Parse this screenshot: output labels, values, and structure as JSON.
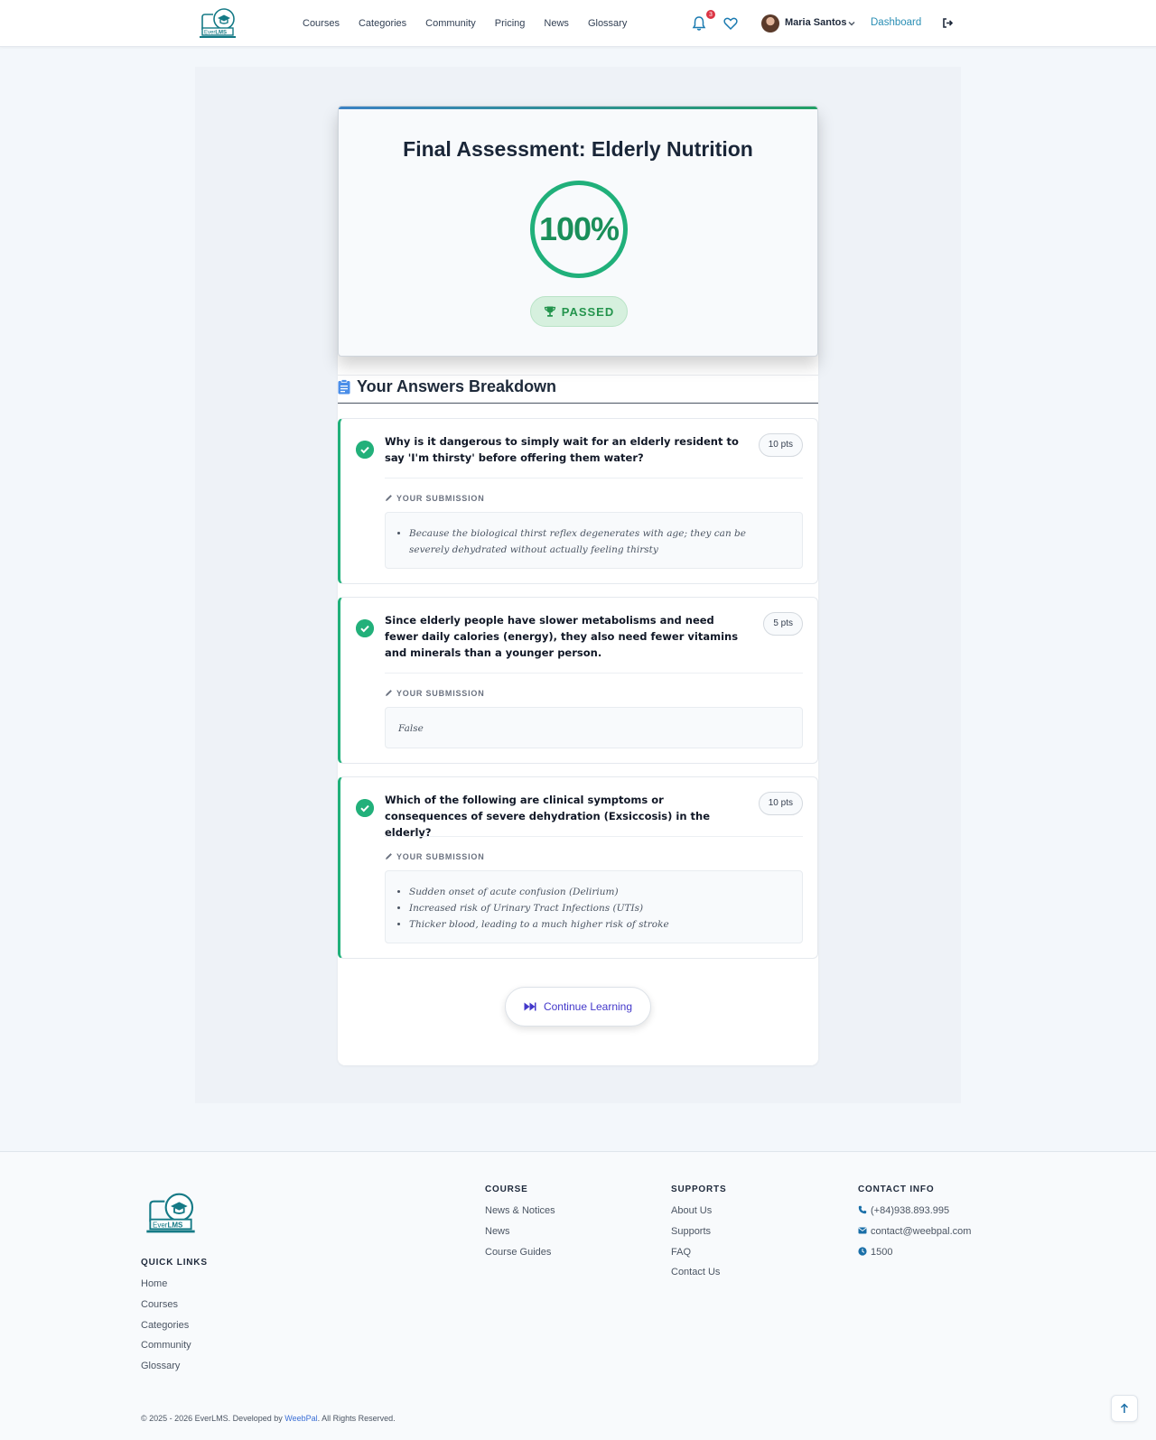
{
  "header": {
    "nav": [
      "Courses",
      "Categories",
      "Community",
      "Pricing",
      "News",
      "Glossary"
    ],
    "notification_count": "3",
    "user_name": "Maria Santos",
    "dashboard_label": "Dashboard"
  },
  "result": {
    "title": "Final Assessment: Elderly Nutrition",
    "score": "100%",
    "status": "PASSED"
  },
  "breakdown": {
    "title": "Your Answers Breakdown",
    "submission_label": "YOUR SUBMISSION",
    "questions": [
      {
        "text": "Why is it dangerous to simply wait for an elderly resident to say 'I'm thirsty' before offering them water?",
        "points": "10 pts",
        "answers": [
          "Because the biological thirst reflex degenerates with age; they can be severely dehydrated without actually feeling thirsty"
        ]
      },
      {
        "text": "Since elderly people have slower metabolisms and need fewer daily calories (energy), they also need fewer vitamins and minerals than a younger person.",
        "points": "5 pts",
        "answer_plain": "False"
      },
      {
        "text": "Which of the following are clinical symptoms or consequences of severe dehydration (Exsiccosis) in the elderly?",
        "points": "10 pts",
        "answers": [
          "Sudden onset of acute confusion (Delirium)",
          "Increased risk of Urinary Tract Infections (UTIs)",
          "Thicker blood, leading to a much higher risk of stroke"
        ]
      }
    ]
  },
  "continue_label": "Continue Learning",
  "footer": {
    "quick_links_title": "QUICK LINKS",
    "quick_links": [
      "Home",
      "Courses",
      "Categories",
      "Community",
      "Glossary"
    ],
    "course_title": "COURSE",
    "course_links": [
      "News & Notices",
      "News",
      "Course Guides"
    ],
    "supports_title": "SUPPORTS",
    "supports_links": [
      "About Us",
      "Supports",
      "FAQ",
      "Contact Us"
    ],
    "contact_title": "CONTACT INFO",
    "phone": "(+84)938.893.995",
    "email": "contact@weebpal.com",
    "hotline": "1500",
    "copyright_prefix": "© 2025 - 2026 EverLMS. Developed by ",
    "copyright_link": "WeebPal",
    "copyright_suffix": ". All Rights Reserved."
  },
  "colors": {
    "accent_green": "#20b07a",
    "link_blue": "#2b8fb5",
    "button_indigo": "#4338ca"
  }
}
